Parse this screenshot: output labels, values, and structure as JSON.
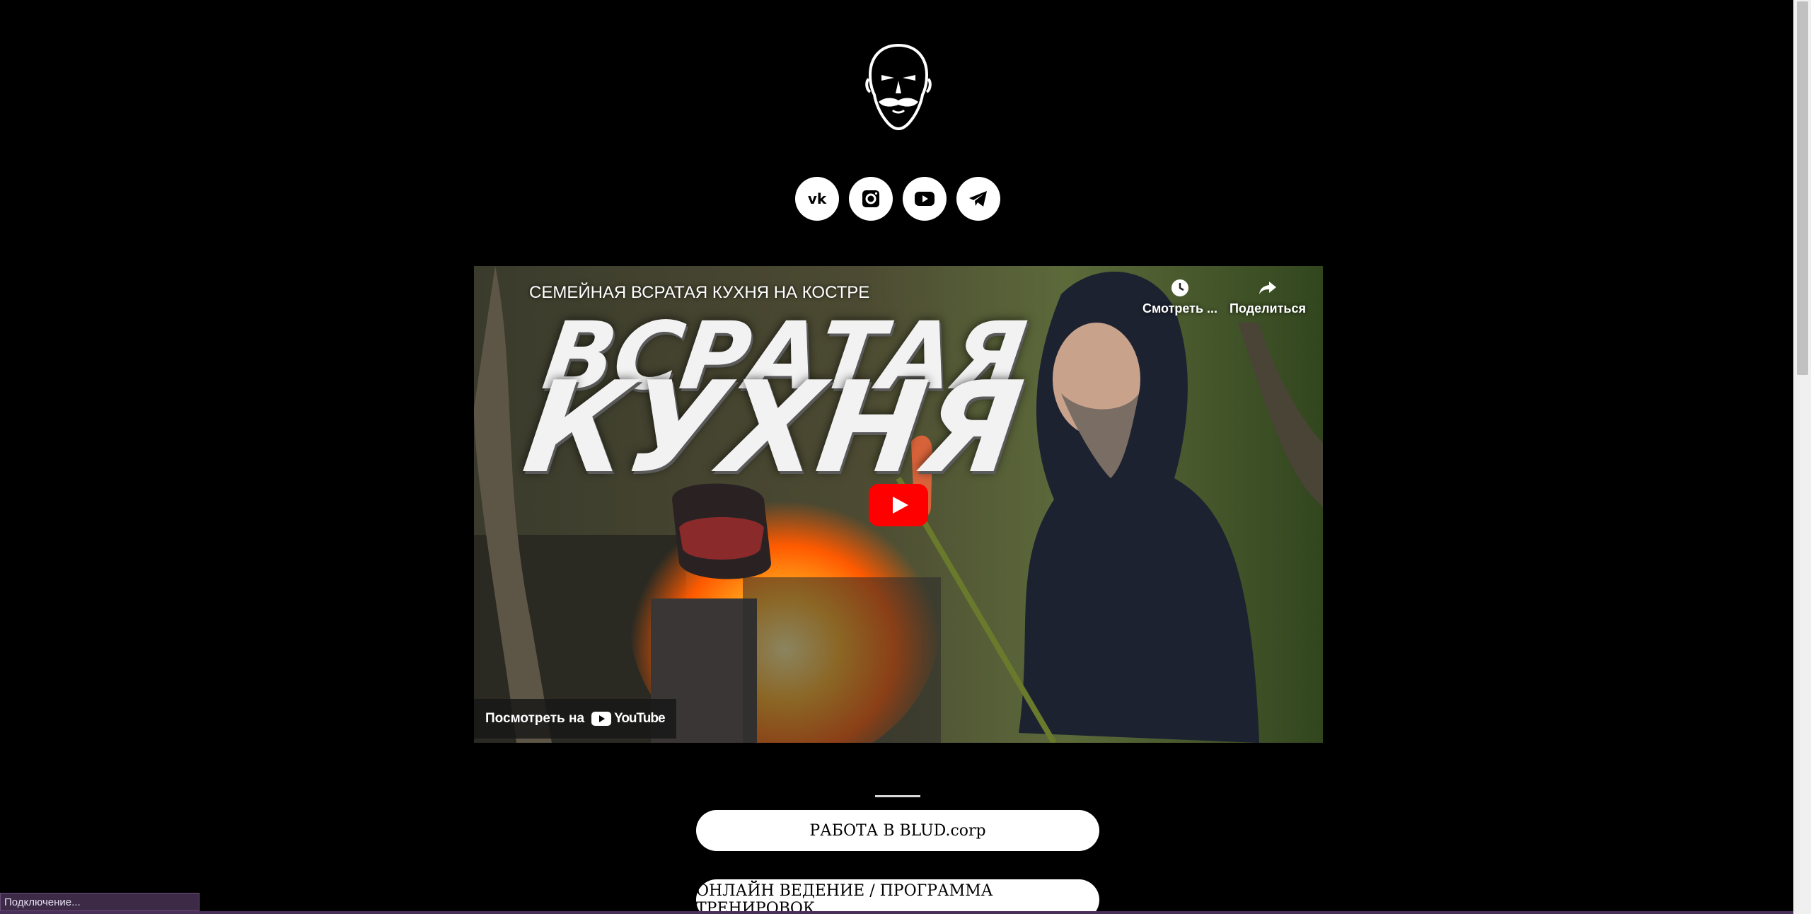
{
  "header": {
    "logo_icon": "bald-mustache-face-logo"
  },
  "socials": [
    {
      "name": "vk",
      "icon": "vk-icon"
    },
    {
      "name": "instagram",
      "icon": "instagram-icon"
    },
    {
      "name": "youtube",
      "icon": "youtube-icon"
    },
    {
      "name": "telegram",
      "icon": "telegram-icon"
    }
  ],
  "video": {
    "title": "СЕМЕЙНАЯ ВСРАТАЯ КУХНЯ НА КОСТРЕ",
    "thumbnail_line1": "ВСРАТАЯ",
    "thumbnail_line2": "КУХНЯ",
    "watch_later_label": "Смотреть ...",
    "share_label": "Поделиться",
    "watch_on_label": "Посмотреть на",
    "youtube_wordmark": "YouTube"
  },
  "links": [
    {
      "label": "РАБОТА В BLUD.corp"
    },
    {
      "label": "ОНЛАЙН ВЕДЕНИЕ / ПРОГРАММА ТРЕНИРОВОК"
    }
  ],
  "status_bar": {
    "text": "Подключение..."
  },
  "colors": {
    "background": "#000000",
    "button_bg": "#ffffff",
    "youtube_red": "#ff0000"
  }
}
